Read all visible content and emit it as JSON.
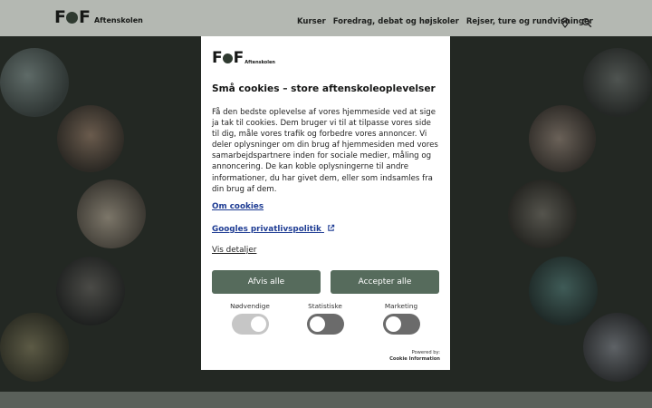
{
  "header": {
    "logo_mark": "FOF",
    "logo_text": "Aftenskolen",
    "nav": [
      {
        "label": "Kurser"
      },
      {
        "label": "Foredrag, debat og højskoler"
      },
      {
        "label": "Rejser, ture og rundvisninger"
      }
    ],
    "icons": [
      "location-pin-icon",
      "search-icon"
    ]
  },
  "dialog": {
    "logo_mark": "FOF",
    "logo_text": "Aftenskolen",
    "title": "Små cookies – store aftenskoleoplevelser",
    "body": "Få den bedste oplevelse af vores hjemmeside ved at sige ja tak til cookies. Dem bruger vi til at tilpasse vores side til dig, måle vores trafik og forbedre vores annoncer. Vi deler oplysninger om din brug af hjemmesiden med vores samarbejdspartnere inden for sociale medier, måling og annoncering. De kan koble oplysningerne til andre informationer, du har givet dem, eller som indsamles fra din brug af dem.",
    "link_about": "Om cookies",
    "link_google": "Googles privatlivspolitik",
    "link_details": "Vis detaljer",
    "btn_reject": "Afvis alle",
    "btn_accept": "Accepter alle",
    "toggles": [
      {
        "label": "Nødvendige",
        "on": true,
        "disabled": true
      },
      {
        "label": "Statistiske",
        "on": false
      },
      {
        "label": "Marketing",
        "on": false
      }
    ],
    "powered_by": "Powered by:",
    "powered_name": "Cookie Information"
  },
  "colors": {
    "button": "#566b5c",
    "link": "#1d3b93",
    "backdrop": "#232823",
    "toggle_off": "#6b6b6b",
    "toggle_disabled": "#bcbcbc"
  }
}
